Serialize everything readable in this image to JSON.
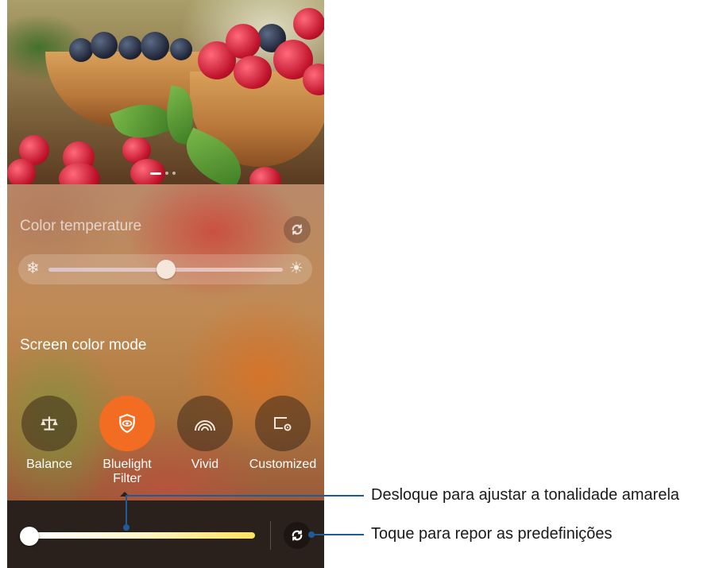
{
  "color_temperature": {
    "label": "Color temperature",
    "slider_value_fraction": 0.5
  },
  "screen_color_mode": {
    "label": "Screen color mode",
    "modes": [
      {
        "label": "Balance",
        "icon": "scale-icon",
        "selected": false
      },
      {
        "label": "Bluelight\nFilter",
        "icon": "eye-shield-icon",
        "selected": true
      },
      {
        "label": "Vivid",
        "icon": "rainbow-icon",
        "selected": false
      },
      {
        "label": "Customized",
        "icon": "screen-settings-icon",
        "selected": false
      }
    ]
  },
  "bluelight": {
    "slider_value_fraction": 0.0
  },
  "wallpaper": {
    "page_count": 3,
    "active_page": 1
  },
  "callouts": {
    "slider": "Desloque para ajustar a tonalidade amarela",
    "reset": "Toque para repor as predefinições"
  },
  "colors": {
    "accent": "#f26d21",
    "callout_line": "#1f5a9b",
    "bottom_bar": "#2b211c"
  }
}
